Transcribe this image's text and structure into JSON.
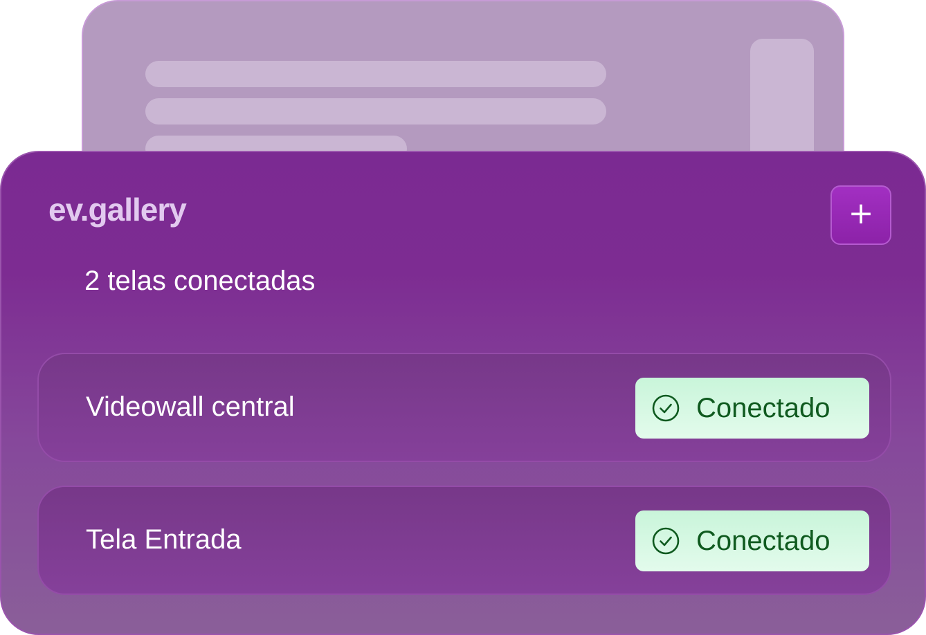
{
  "brand": {
    "name": "ev.gallery"
  },
  "header": {
    "add_button_label": "+"
  },
  "summary": {
    "connected_count_text": "2 telas conectadas"
  },
  "screens": [
    {
      "name": "Videowall central",
      "status": "Conectado",
      "status_icon": "check-circle-icon"
    },
    {
      "name": "Tela Entrada",
      "status": "Conectado",
      "status_icon": "check-circle-icon"
    }
  ],
  "colors": {
    "card_background": "#7b2a92",
    "brand_text": "#e2c9ef",
    "add_button": "#a22fc2",
    "status_badge": "#c9f5da",
    "status_text": "#0f5a1f"
  }
}
